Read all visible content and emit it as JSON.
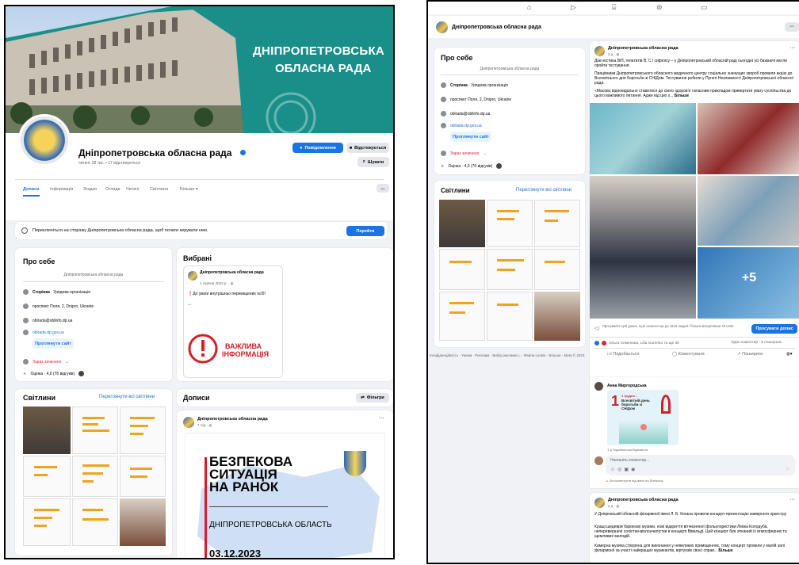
{
  "page": {
    "name": "Дніпропетровська обласна рада",
    "stats": "читачі: 28 тис. • 17 відстежуються",
    "banner_title": "ДНІПРОПЕТРОВСЬКА",
    "banner_sub": "ОБЛАСНА РАДА"
  },
  "header_buttons": {
    "notify": "Повідомлення",
    "follow": "Відстежується",
    "search": "Шукати",
    "more": "..."
  },
  "tabs": [
    "Дописи",
    "Інформація",
    "Згадки",
    "Огляди",
    "Читачі",
    "Світлини",
    "Більше ▾"
  ],
  "switch_bar": {
    "text": "Переключіться на сторінку Дніпропетровська обласна рада, щоб почати керувати нею.",
    "button": "Перейти"
  },
  "about": {
    "title": "Про себе",
    "subtitle": "Дніпропетровська обласна рада",
    "page_type_label": "Сторінка",
    "page_type": " · Урядова організація",
    "address": "проспект Поля, 2, Dnipro, Ukraine",
    "email": "oblrada@oblinfo.dp.ua",
    "website": "oblrada.dp.gov.ua",
    "visit_button": "Проглянути сайт",
    "open_status": "Зараз зачинено",
    "rating": "Оцінка · 4,0 (76 відгуків)"
  },
  "photos": {
    "title": "Світлини",
    "see_all": "Переглянути всі світлини"
  },
  "featured": {
    "title": "Вибрані",
    "author": "Дніпропетровська обласна рада",
    "date": "1 серпня 2022 р. · ",
    "text": "❗До уваги внутрішньо переміщених осіб!",
    "ellipsis": "...",
    "banner_line1": "ВАЖЛИВА",
    "banner_line2": "ІНФОРМАЦІЯ"
  },
  "posts": {
    "title": "Дописи",
    "filters": "Фільтри"
  },
  "post1": {
    "author": "Дніпропетровська обласна рада",
    "time": "7 год · ",
    "headline": [
      "БЕЗПЕКОВА",
      "СИТУАЦІЯ",
      "НА РАНОК"
    ],
    "region": "ДНІПРОПЕТРОВСЬКА ОБЛАСТЬ",
    "date": "03.12.2023"
  },
  "top_nav": {
    "page_name": "Дніпропетровська обласна рада"
  },
  "footer_links": "Конфіденційність · Умови · Реклама · Вибір реклами ▷ · Файли cookie · Більше · Meta © 2023",
  "post2": {
    "author": "Дніпропетровська обласна рада",
    "time": "2 д · ",
    "text1": "Діагностика ВІЛ, гепатитів В, С і сифілісу – у Дніпропетровській обласній раді сьогодні усі бажаючі могли пройти тестування.",
    "text2": "Працівники Дніпропетровського обласного медичного центру соціально значущих хвороб провели акцію до Всесвітнього дня боротьби зі СНІДом. Тестування робили у Пункті Незламності Дніпропетровської обласної ради.",
    "text3": "«Масово відповідально ставитися до свого здоров'я і власним прикладом привертати увагу суспільства до цього важливого питання. Адже від цих х...",
    "more": " Більше",
    "photo_more": "+5",
    "boost_text": "Просувайте цей допис, щоб охопити ще до 1916 людей і більше витративши 45 USD.",
    "boost_button": "Просувати допис",
    "reactions": "Ольга Семенова, Lilia Gurenko та ще 30",
    "comments_shares": "Один коментар · 5 поширень",
    "like": "Подобається",
    "comment": "Коментувати",
    "share": "Поширити"
  },
  "comment": {
    "author": "Анна Миргородська",
    "card_top": "1 грудня –",
    "card_text": "Всесвітній день боротьби зі СНІДом",
    "card_num": "1",
    "meta": "1 д   Подобається   Відповісти",
    "placeholder": "Напишіть коментар...",
    "notice": "Ви коментуєте від імені Ira Shelpova."
  },
  "post3": {
    "author": "Дніпропетровська обласна рада",
    "time": "2 д · ",
    "text1": "У Дніпровській обласній філармонії імені Л. Б. Когана провели концерт-презентацію камерного оркестру",
    "text2": "Кращі шедеври бароково музики, нові відкриття вітчизняної фольклористики Левка Колодуба, неперевершені солістки-віолончелістки в концерті Вівальді. Цей концерт був зітканий із атмосферних та щемливих мелодій.",
    "text3": "Камерна музика створена для виконання у невеликих приміщеннях, тому концерт провели у малій залі філармонії за участі найкращих музикантів, віртуозів своєї справ...",
    "more": " Більше"
  },
  "colors": {
    "accent": "#1b74e4",
    "banner_teal": "#1a8f8a",
    "alert_red": "#d32027",
    "map_blue": "#cfe0f5"
  }
}
